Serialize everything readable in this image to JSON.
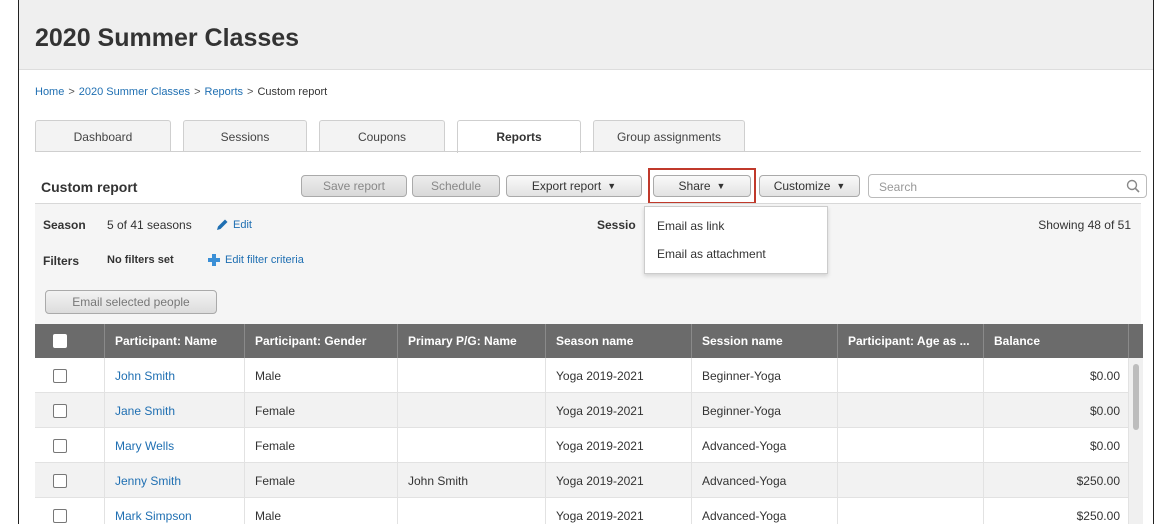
{
  "page_title": "2020 Summer Classes",
  "breadcrumb": [
    {
      "label": "Home"
    },
    {
      "label": "2020 Summer Classes"
    },
    {
      "label": "Reports"
    },
    {
      "label": "Custom report"
    }
  ],
  "breadcrumb_sep": ">",
  "tabs": [
    {
      "label": "Dashboard"
    },
    {
      "label": "Sessions"
    },
    {
      "label": "Coupons"
    },
    {
      "label": "Reports",
      "active": true
    },
    {
      "label": "Group assignments"
    }
  ],
  "report": {
    "title": "Custom report",
    "save_label": "Save report",
    "schedule_label": "Schedule",
    "export_label": "Export report",
    "share_label": "Share",
    "customize_label": "Customize",
    "search_placeholder": "Search"
  },
  "info": {
    "season_label": "Season",
    "season_value": "5 of 41 seasons",
    "edit_label": "Edit",
    "session_label": "Sessio",
    "filters_label": "Filters",
    "filters_value": "No filters set",
    "edit_filter_label": "Edit filter criteria",
    "showing": "Showing 48 of 51",
    "email_selected_label": "Email selected people"
  },
  "share_menu": {
    "items": [
      "Email as link",
      "Email as attachment"
    ]
  },
  "table": {
    "headers": [
      "Participant: Name",
      "Participant: Gender",
      "Primary P/G: Name",
      "Season name",
      "Session name",
      "Participant: Age as ...",
      "Balance"
    ],
    "rows": [
      [
        "John Smith",
        "Male",
        "",
        "Yoga 2019-2021",
        "Beginner-Yoga",
        "",
        "$0.00"
      ],
      [
        "Jane Smith",
        "Female",
        "",
        "Yoga 2019-2021",
        "Beginner-Yoga",
        "",
        "$0.00"
      ],
      [
        "Mary Wells",
        "Female",
        "",
        "Yoga 2019-2021",
        "Advanced-Yoga",
        "",
        "$0.00"
      ],
      [
        "Jenny Smith",
        "Female",
        "John Smith",
        "Yoga 2019-2021",
        "Advanced-Yoga",
        "",
        "$250.00"
      ],
      [
        "Mark Simpson",
        "Male",
        "",
        "Yoga 2019-2021",
        "Advanced-Yoga",
        "",
        "$250.00"
      ]
    ]
  },
  "colors": {
    "link": "#1f6fb2",
    "table_header": "#6b6b6b",
    "highlight_box": "#c0392b"
  }
}
